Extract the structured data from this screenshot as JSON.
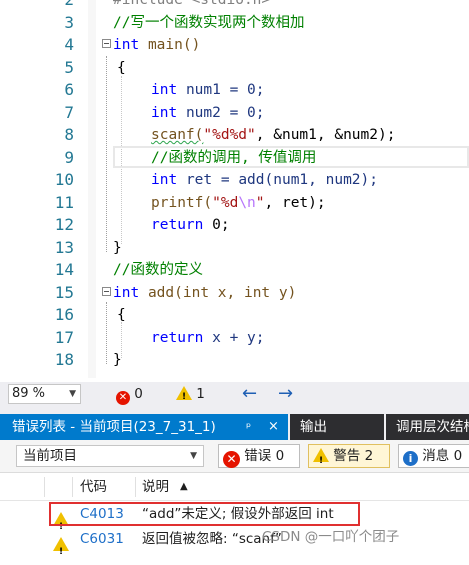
{
  "editor": {
    "lines": [
      {
        "n": "2"
      },
      {
        "n": "3",
        "comment": "//写一个函数实现两个数相加"
      },
      {
        "n": "4"
      },
      {
        "n": "5"
      },
      {
        "n": "6"
      },
      {
        "n": "7"
      },
      {
        "n": "8"
      },
      {
        "n": "9",
        "comment": "//函数的调用, 传值调用"
      },
      {
        "n": "10"
      },
      {
        "n": "11"
      },
      {
        "n": "12"
      },
      {
        "n": "13"
      },
      {
        "n": "14",
        "comment": "//函数的定义"
      },
      {
        "n": "15"
      },
      {
        "n": "16"
      },
      {
        "n": "17"
      },
      {
        "n": "18"
      }
    ],
    "include_text": "#include <stdio.h>",
    "main_sig": "main()",
    "num1_decl": "num1 = 0;",
    "num2_decl": "num2 = 0;",
    "scanf_fmt": "\"%d%d\"",
    "scanf_args": ", &num1, &num2);",
    "ret_decl": "ret = add(num1, num2);",
    "printf_fmt_a": "\"%d",
    "printf_fmt_esc": "\\n",
    "printf_fmt_b": "\"",
    "printf_args": ", ret);",
    "return_main": "0;",
    "add_sig": "add(int x, int y)",
    "return_add": "x + y;",
    "kw_int": "int",
    "kw_return": "return",
    "fn_scanf": "scanf(",
    "fn_printf": "printf(",
    "brace_open": "{",
    "brace_close": "}"
  },
  "statusbar": {
    "zoom": "89 %",
    "error_count": "0",
    "warning_count": "1",
    "back_arrow": "←",
    "forward_arrow": "→"
  },
  "tabs": {
    "active": "错误列表 - 当前项目(23_7_31_1)",
    "pin_icon": "ᵖ",
    "close_icon": "×",
    "output": "输出",
    "call_hierarchy": "调用层次结构"
  },
  "error_list": {
    "scope": "当前项目",
    "errors_btn": "错误 0",
    "warnings_btn": "警告 2",
    "messages_btn": "消息 0",
    "columns": {
      "code": "代码",
      "description": "说明",
      "sort_arrow": "▲"
    },
    "rows": [
      {
        "code": "C4013",
        "description": "“add”未定义; 假设外部返回 int"
      },
      {
        "code": "C6031",
        "description": "返回值被忽略: “scanf”"
      }
    ],
    "accent_color": "#007acc",
    "highlight_color": "#e03030"
  },
  "watermark": "CSDN @一口吖个团子"
}
